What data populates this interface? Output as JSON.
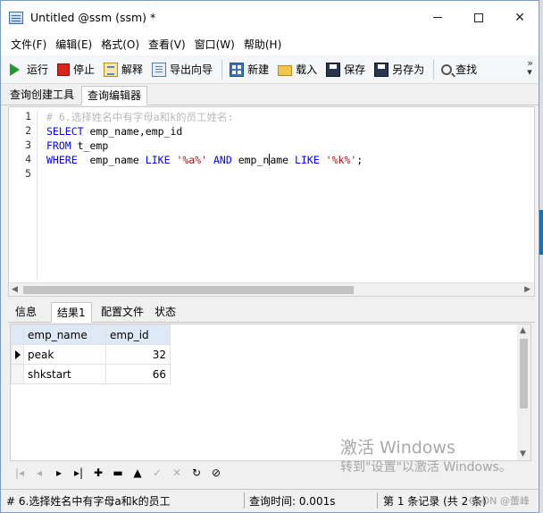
{
  "window": {
    "title": "Untitled @ssm (ssm) *"
  },
  "menu": [
    "文件(F)",
    "编辑(E)",
    "格式(O)",
    "查看(V)",
    "窗口(W)",
    "帮助(H)"
  ],
  "toolbar": {
    "run": "运行",
    "stop": "停止",
    "explain": "解释",
    "export": "导出向导",
    "new": "新建",
    "load": "载入",
    "save": "保存",
    "save_as": "另存为",
    "find": "查找"
  },
  "editor_tabs": [
    "查询创建工具",
    "查询编辑器"
  ],
  "editor": {
    "line_numbers": [
      "1",
      "2",
      "3",
      "4",
      "5"
    ],
    "line1": {
      "comment": "# 6.选择姓名中有字母a和k的员工姓名:"
    },
    "line2": {
      "kw": "SELECT",
      "rest": " emp_name,emp_id"
    },
    "line3": {
      "kw": "FROM",
      "rest": " t_emp"
    },
    "line4": {
      "kw1": "WHERE",
      "p1": "  emp_name ",
      "kw2": "LIKE",
      "sp1": " ",
      "s1": "'%a%'",
      "sp2": " ",
      "kw3": "AND",
      "p2a": " emp_n",
      "p2b": "ame ",
      "kw4": "LIKE",
      "sp3": " ",
      "s2": "'%k%'",
      "end": ";"
    }
  },
  "result_tabs": [
    "信息",
    "结果1",
    "配置文件",
    "状态"
  ],
  "grid": {
    "columns": [
      "emp_name",
      "emp_id"
    ],
    "rows": [
      {
        "emp_name": "peak",
        "emp_id": "32"
      },
      {
        "emp_name": "shkstart",
        "emp_id": "66"
      }
    ]
  },
  "status": {
    "query": "# 6.选择姓名中有字母a和k的员工",
    "time": "查询时间: 0.001s",
    "record": "第 1 条记录 (共 2 条)"
  },
  "watermark": {
    "title": "激活 Windows",
    "subtitle": "转到\"设置\"以激活 Windows。"
  },
  "csdn": "CSDN @蕾峰"
}
